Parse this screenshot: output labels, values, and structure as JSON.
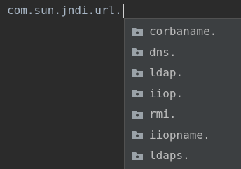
{
  "editor": {
    "typed_text": "com.sun.jndi.url."
  },
  "completion_popup": {
    "items": [
      {
        "label": "corbaname.",
        "icon": "package-folder-icon"
      },
      {
        "label": "dns.",
        "icon": "package-folder-icon"
      },
      {
        "label": "ldap.",
        "icon": "package-folder-icon"
      },
      {
        "label": "iiop.",
        "icon": "package-folder-icon"
      },
      {
        "label": "rmi.",
        "icon": "package-folder-icon"
      },
      {
        "label": "iiopname.",
        "icon": "package-folder-icon"
      },
      {
        "label": "ldaps.",
        "icon": "package-folder-icon"
      }
    ]
  },
  "colors": {
    "editor_background": "#2b2b2b",
    "popup_background": "#3c3f41",
    "text": "#a9b7c6",
    "icon": "#9aa2a8"
  }
}
